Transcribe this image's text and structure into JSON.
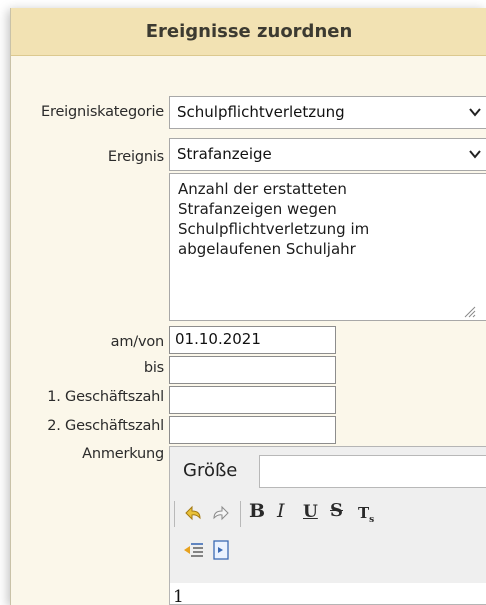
{
  "dialog": {
    "title": "Ereignisse zuordnen"
  },
  "form": {
    "category": {
      "label": "Ereigniskategorie",
      "value": "Schulpflichtverletzung"
    },
    "event": {
      "label": "Ereignis",
      "value": "Strafanzeige"
    },
    "description_lines": [
      "Anzahl der erstatteten",
      "Strafanzeigen wegen",
      "Schulpflichtverletzung im",
      "abgelaufenen Schuljahr"
    ],
    "from": {
      "label": "am/von",
      "value": "01.10.2021"
    },
    "to": {
      "label": "bis",
      "value": ""
    },
    "case_number_1": {
      "label": "1. Geschäftszahl",
      "value": ""
    },
    "case_number_2": {
      "label": "2. Geschäftszahl",
      "value": ""
    },
    "note": {
      "label": "Anmerkung"
    }
  },
  "editor": {
    "size_label": "Größe",
    "content": "1",
    "icons": [
      "undo-icon",
      "redo-icon",
      "bold-icon",
      "italic-icon",
      "underline-icon",
      "strikethrough-icon",
      "subscript-icon",
      "outdent-icon",
      "indent-icon"
    ],
    "bold_glyph": "B",
    "italic_glyph": "I",
    "underline_glyph": "U",
    "strike_glyph": "S",
    "subscript_glyph": "T"
  },
  "colors": {
    "frame_bg": "#fbf7ea",
    "title_bg": "#f2e2b3"
  }
}
